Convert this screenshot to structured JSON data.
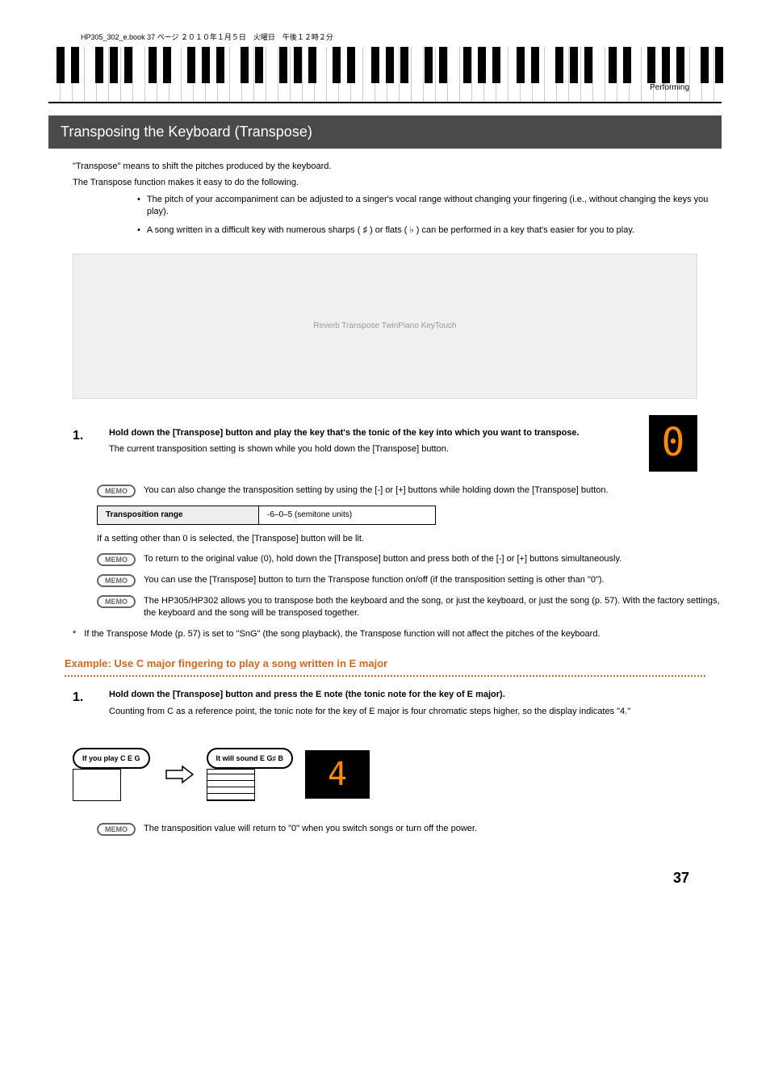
{
  "book_info": "HP305_302_e.book 37 ページ ２０１０年１月５日　火曜日　午後１２時２分",
  "header_label": "Performing",
  "section_title": "Transposing the Keyboard (Transpose)",
  "intro": {
    "p1": "\"Transpose\" means to shift the pitches produced by the keyboard.",
    "p2": "The Transpose function makes it easy to do the following.",
    "bullets": [
      "The pitch of your accompaniment can be adjusted to a singer's vocal range without changing your fingering (i.e., without changing the keys you play).",
      "A song written in a difficult key with numerous sharps ( ♯ ) or flats ( ♭ ) can be performed in a key that's easier for you to play."
    ]
  },
  "panel_placeholder": "Reverb  Transpose  TwinPiano  KeyTouch",
  "step1": {
    "num": "1.",
    "title": "Hold down the [Transpose] button and play the key that's the tonic of the key into which you want to transpose.",
    "text": "The current transposition setting is shown while you hold down the [Transpose] button.",
    "display_value": "0"
  },
  "memo1": "You can also change the transposition setting by using the [-] or [+] buttons while holding down the [Transpose] button.",
  "table": {
    "label": "Transposition range",
    "value": "-6–0–5 (semitone units)"
  },
  "note1": "If a setting other than 0 is selected, the [Transpose] button will be lit.",
  "memo2": "To return to the original value (0), hold down the [Transpose] button and press both of the [-] or [+] buttons simultaneously.",
  "memo3": "You can use the [Transpose] button to turn the Transpose function on/off (if the transposition setting is other than \"0\").",
  "memo4": "The HP305/HP302 allows you to transpose both the keyboard and the song, or just the keyboard, or just the song (p. 57). With the factory settings, the keyboard and the song will be transposed together.",
  "asterisk_note": "If the Transpose Mode (p. 57) is set to \"SnG\" (the song playback), the Transpose function will not affect the pitches of the keyboard.",
  "example_heading": "Example: Use C major fingering to play a song written in E major",
  "example_step": {
    "num": "1.",
    "title": "Hold down the [Transpose] button and press the E note (the tonic note for the key of E major).",
    "text": "Counting from C as a reference point, the tonic note for the key of E major is four chromatic steps higher, so the display indicates \"4.\""
  },
  "diagram": {
    "left_label": "If you play C E G",
    "right_label": "It will sound E G♯ B",
    "display_value": "4"
  },
  "memo5": "The transposition value will return to \"0\" when you switch songs or turn off the power.",
  "memo_label": "MEMO",
  "asterisk": "*",
  "bullet_char": "•",
  "page_num": "37"
}
